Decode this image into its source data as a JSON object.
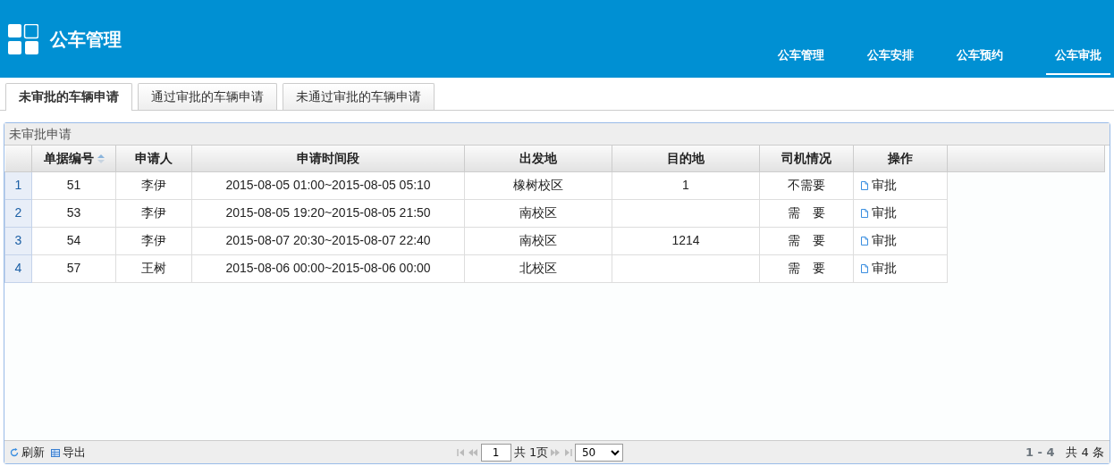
{
  "header": {
    "title": "公车管理",
    "nav": [
      {
        "label": "公车管理",
        "selected": false
      },
      {
        "label": "公车安排",
        "selected": false
      },
      {
        "label": "公车预约",
        "selected": false
      },
      {
        "label": "公车审批",
        "selected": true
      }
    ]
  },
  "tabs": [
    {
      "label": "未审批的车辆申请",
      "selected": true
    },
    {
      "label": "通过审批的车辆申请",
      "selected": false
    },
    {
      "label": "未通过审批的车辆申请",
      "selected": false
    }
  ],
  "grid": {
    "title": "未审批申请",
    "columns": [
      {
        "label": "单据编号",
        "sortable": true
      },
      {
        "label": "申请人",
        "sortable": false
      },
      {
        "label": "申请时间段",
        "sortable": false
      },
      {
        "label": "出发地",
        "sortable": false
      },
      {
        "label": "目的地",
        "sortable": false
      },
      {
        "label": "司机情况",
        "sortable": false
      },
      {
        "label": "操作",
        "sortable": false
      }
    ],
    "rows": [
      {
        "row_number": "1",
        "cells": [
          "51",
          "李伊",
          "2015-08-05 01:00~2015-08-05 05:10",
          "橡树校区",
          "1",
          "不需要"
        ],
        "action": "审批"
      },
      {
        "row_number": "2",
        "cells": [
          "53",
          "李伊",
          "2015-08-05 19:20~2015-08-05 21:50",
          "南校区",
          "",
          "需　要"
        ],
        "action": "审批"
      },
      {
        "row_number": "3",
        "cells": [
          "54",
          "李伊",
          "2015-08-07 20:30~2015-08-07 22:40",
          "南校区",
          "1214",
          "需　要"
        ],
        "action": "审批"
      },
      {
        "row_number": "4",
        "cells": [
          "57",
          "王树",
          "2015-08-06 00:00~2015-08-06 00:00",
          "北校区",
          "",
          "需　要"
        ],
        "action": "审批"
      }
    ],
    "toolbar": [
      {
        "kind": "refresh",
        "label": "刷新"
      },
      {
        "kind": "export",
        "label": "导出"
      }
    ],
    "pager": {
      "page": "1",
      "total_pages": "共 1页",
      "page_size": "50",
      "range": "1 - 4",
      "total": "共 4 条"
    }
  }
}
